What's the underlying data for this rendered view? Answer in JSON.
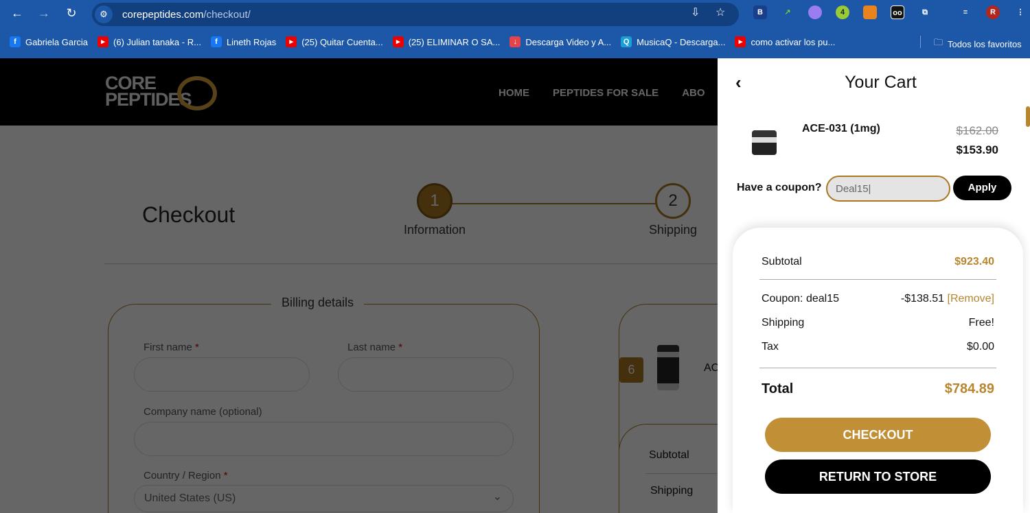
{
  "browser": {
    "url_host": "corepeptides.com",
    "url_path": "/checkout/",
    "profile_initial": "R",
    "ext_badge": "4",
    "bookmarks": [
      {
        "label": "Gabriela Garcia",
        "icon": "facebook-icon"
      },
      {
        "label": "(6) Julian tanaka - R...",
        "icon": "youtube-icon"
      },
      {
        "label": "Lineth Rojas",
        "icon": "facebook-icon"
      },
      {
        "label": "(25) Quitar Cuenta...",
        "icon": "youtube-icon"
      },
      {
        "label": "(25) ELIMINAR O SA...",
        "icon": "youtube-icon"
      },
      {
        "label": "Descarga Video y A...",
        "icon": "download-icon"
      },
      {
        "label": "MusicaQ - Descarga...",
        "icon": "musicaq-icon"
      },
      {
        "label": "como activar los pu...",
        "icon": "youtube-icon"
      }
    ],
    "all_bookmarks": "Todos los favoritos"
  },
  "site": {
    "logo_line1": "CORE",
    "logo_line2": "PEPTIDES",
    "menu": [
      "HOME",
      "PEPTIDES FOR SALE",
      "ABO"
    ]
  },
  "checkout": {
    "title": "Checkout",
    "steps": [
      {
        "num": "1",
        "label": "Information"
      },
      {
        "num": "2",
        "label": "Shipping"
      }
    ],
    "billing_title": "Billing details",
    "first_name": "First name",
    "last_name": "Last name",
    "company": "Company name (optional)",
    "country": "Country / Region",
    "country_value": "United States (US)",
    "required": "*",
    "order_qty": "6",
    "order_item": "AC",
    "subtotal": "Subtotal",
    "shipping": "Shipping"
  },
  "cart": {
    "title": "Your Cart",
    "item_name": "ACE-031 (1mg)",
    "old_price": "$162.00",
    "new_price": "$153.90",
    "coupon_label": "Have a coupon?",
    "coupon_value": "Deal15",
    "apply": "Apply",
    "subtotal_label": "Subtotal",
    "subtotal": "$923.40",
    "coupon_line": "Coupon: deal15",
    "coupon_discount": "-$138.51",
    "remove": "[Remove]",
    "shipping_label": "Shipping",
    "shipping": "Free!",
    "tax_label": "Tax",
    "tax": "$0.00",
    "total_label": "Total",
    "total": "$784.89",
    "checkout": "CHECKOUT",
    "return": "RETURN TO STORE"
  },
  "colors": {
    "accent": "#b8862e",
    "chrome": "#1c57a8"
  }
}
